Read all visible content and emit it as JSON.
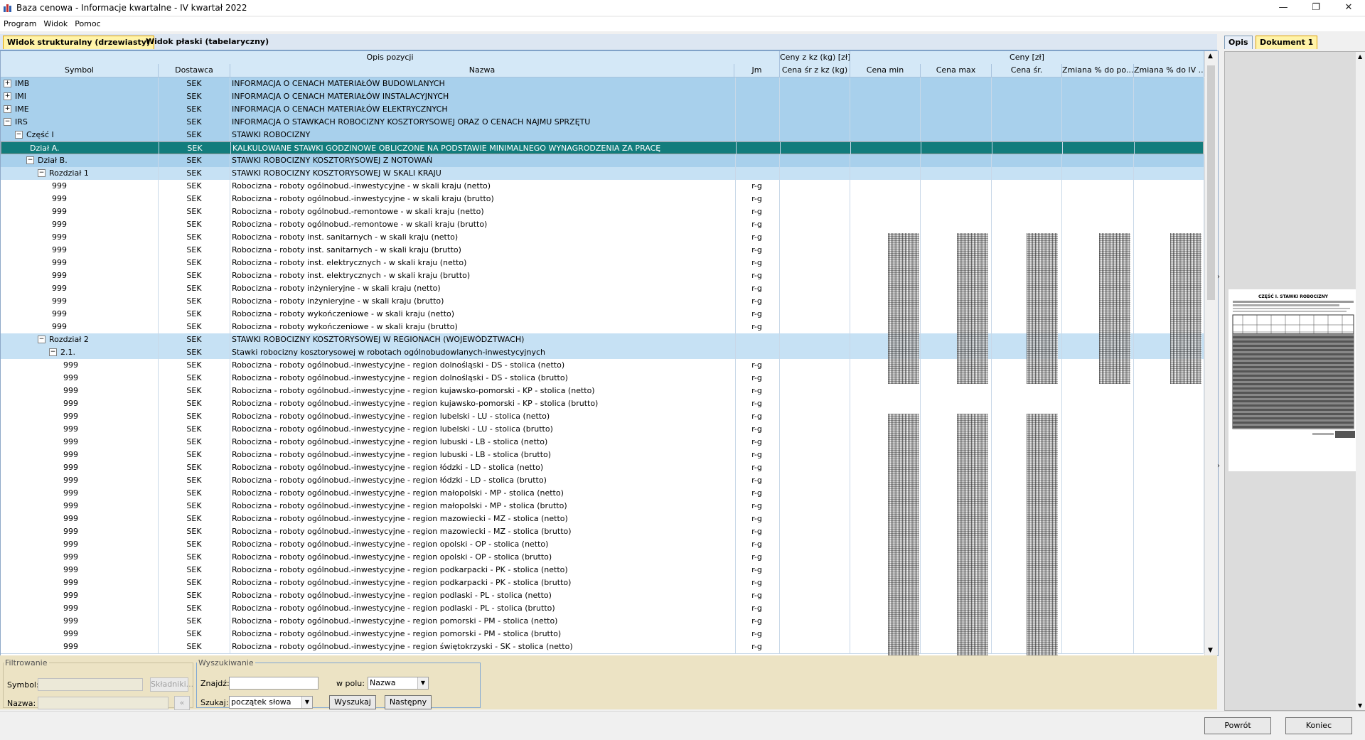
{
  "window": {
    "title": "Baza cenowa - Informacje kwartalne - IV kwartał 2022"
  },
  "menu": [
    "Program",
    "Widok",
    "Pomoc"
  ],
  "tabs": {
    "tree": "Widok strukturalny (drzewiasty)",
    "flat": "Widok płaski (tabelaryczny)"
  },
  "grid": {
    "groups": {
      "opis": "Opis pozycji",
      "kz": "Ceny z kz (kg) [zł]",
      "ceny": "Ceny [zł]"
    },
    "columns": {
      "symbol": "Symbol",
      "dostawca": "Dostawca",
      "nazwa": "Nazwa",
      "jm": "Jm",
      "kz": "Cena śr z kz (kg)",
      "min": "Cena min",
      "max": "Cena max",
      "sr": "Cena śr.",
      "z1": "Zmiana % do po...",
      "z2": "Zmiana % do IV ..."
    },
    "rows": [
      {
        "sym": "IMB",
        "lvl": 0,
        "tb": "+",
        "dos": "SEK",
        "naz": "INFORMACJA O CENACH MATERIAŁÓW BUDOWLANYCH",
        "jm": "",
        "t": "cat"
      },
      {
        "sym": "IMI",
        "lvl": 0,
        "tb": "+",
        "dos": "SEK",
        "naz": "INFORMACJA O CENACH MATERIAŁÓW INSTALACYJNYCH",
        "jm": "",
        "t": "cat"
      },
      {
        "sym": "IME",
        "lvl": 0,
        "tb": "+",
        "dos": "SEK",
        "naz": "INFORMACJA O CENACH MATERIAŁÓW ELEKTRYCZNYCH",
        "jm": "",
        "t": "cat"
      },
      {
        "sym": "IRS",
        "lvl": 0,
        "tb": "−",
        "dos": "SEK",
        "naz": "INFORMACJA O STAWKACH ROBOCIZNY KOSZTORYSOWEJ ORAZ O CENACH NAJMU SPRZĘTU",
        "jm": "",
        "t": "cat"
      },
      {
        "sym": "Część I",
        "lvl": 1,
        "tb": "−",
        "dos": "SEK",
        "naz": "STAWKI ROBOCIZNY",
        "jm": "",
        "t": "cat"
      },
      {
        "sym": "Dział A.",
        "lvl": 2,
        "tb": "",
        "dos": "SEK",
        "naz": "KALKULOWANE STAWKI GODZINOWE OBLICZONE NA PODSTAWIE MINIMALNEGO WYNAGRODZENIA ZA PRACĘ",
        "jm": "",
        "t": "sel"
      },
      {
        "sym": "Dział B.",
        "lvl": 2,
        "tb": "−",
        "dos": "SEK",
        "naz": "STAWKI ROBOCIZNY KOSZTORYSOWEJ Z NOTOWAŃ",
        "jm": "",
        "t": "cat"
      },
      {
        "sym": "Rozdział 1",
        "lvl": 3,
        "tb": "−",
        "dos": "SEK",
        "naz": "STAWKI ROBOCIZNY KOSZTORYSOWEJ W SKALI KRAJU",
        "jm": "",
        "t": "sub"
      },
      {
        "sym": "999",
        "lvl": 4,
        "tb": "",
        "dos": "SEK",
        "naz": "Robocizna - roboty ogólnobud.-inwestycyjne - w skali kraju (netto)",
        "jm": "r-g",
        "t": "item"
      },
      {
        "sym": "999",
        "lvl": 4,
        "tb": "",
        "dos": "SEK",
        "naz": "Robocizna - roboty ogólnobud.-inwestycyjne - w skali kraju (brutto)",
        "jm": "r-g",
        "t": "item"
      },
      {
        "sym": "999",
        "lvl": 4,
        "tb": "",
        "dos": "SEK",
        "naz": "Robocizna - roboty ogólnobud.-remontowe - w skali kraju (netto)",
        "jm": "r-g",
        "t": "item"
      },
      {
        "sym": "999",
        "lvl": 4,
        "tb": "",
        "dos": "SEK",
        "naz": "Robocizna - roboty ogólnobud.-remontowe - w skali kraju (brutto)",
        "jm": "r-g",
        "t": "item"
      },
      {
        "sym": "999",
        "lvl": 4,
        "tb": "",
        "dos": "SEK",
        "naz": "Robocizna - roboty inst. sanitarnych - w skali kraju (netto)",
        "jm": "r-g",
        "t": "item"
      },
      {
        "sym": "999",
        "lvl": 4,
        "tb": "",
        "dos": "SEK",
        "naz": "Robocizna - roboty inst. sanitarnych - w skali kraju (brutto)",
        "jm": "r-g",
        "t": "item"
      },
      {
        "sym": "999",
        "lvl": 4,
        "tb": "",
        "dos": "SEK",
        "naz": "Robocizna - roboty inst. elektrycznych - w skali kraju (netto)",
        "jm": "r-g",
        "t": "item"
      },
      {
        "sym": "999",
        "lvl": 4,
        "tb": "",
        "dos": "SEK",
        "naz": "Robocizna - roboty inst. elektrycznych - w skali kraju (brutto)",
        "jm": "r-g",
        "t": "item"
      },
      {
        "sym": "999",
        "lvl": 4,
        "tb": "",
        "dos": "SEK",
        "naz": "Robocizna - roboty inżynieryjne - w skali kraju (netto)",
        "jm": "r-g",
        "t": "item"
      },
      {
        "sym": "999",
        "lvl": 4,
        "tb": "",
        "dos": "SEK",
        "naz": "Robocizna - roboty inżynieryjne - w skali kraju (brutto)",
        "jm": "r-g",
        "t": "item"
      },
      {
        "sym": "999",
        "lvl": 4,
        "tb": "",
        "dos": "SEK",
        "naz": "Robocizna - roboty wykończeniowe - w skali kraju (netto)",
        "jm": "r-g",
        "t": "item"
      },
      {
        "sym": "999",
        "lvl": 4,
        "tb": "",
        "dos": "SEK",
        "naz": "Robocizna - roboty wykończeniowe - w skali kraju (brutto)",
        "jm": "r-g",
        "t": "item"
      },
      {
        "sym": "Rozdział 2",
        "lvl": 3,
        "tb": "−",
        "dos": "SEK",
        "naz": "STAWKI ROBOCIZNY KOSZTORYSOWEJ W REGIONACH (WOJEWÓDZTWACH)",
        "jm": "",
        "t": "sub"
      },
      {
        "sym": "2.1.",
        "lvl": 4,
        "tb": "−",
        "dos": "SEK",
        "naz": "Stawki robocizny kosztorysowej w robotach ogólnobudowlanych-inwestycyjnych",
        "jm": "",
        "t": "sub"
      },
      {
        "sym": "999",
        "lvl": 5,
        "tb": "",
        "dos": "SEK",
        "naz": "Robocizna - roboty ogólnobud.-inwestycyjne - region dolnośląski - DS - stolica (netto)",
        "jm": "r-g",
        "t": "item"
      },
      {
        "sym": "999",
        "lvl": 5,
        "tb": "",
        "dos": "SEK",
        "naz": "Robocizna - roboty ogólnobud.-inwestycyjne - region dolnośląski - DS - stolica (brutto)",
        "jm": "r-g",
        "t": "item"
      },
      {
        "sym": "999",
        "lvl": 5,
        "tb": "",
        "dos": "SEK",
        "naz": "Robocizna - roboty ogólnobud.-inwestycyjne - region kujawsko-pomorski - KP - stolica (netto)",
        "jm": "r-g",
        "t": "item"
      },
      {
        "sym": "999",
        "lvl": 5,
        "tb": "",
        "dos": "SEK",
        "naz": "Robocizna - roboty ogólnobud.-inwestycyjne - region kujawsko-pomorski - KP - stolica (brutto)",
        "jm": "r-g",
        "t": "item"
      },
      {
        "sym": "999",
        "lvl": 5,
        "tb": "",
        "dos": "SEK",
        "naz": "Robocizna - roboty ogólnobud.-inwestycyjne - region lubelski - LU - stolica (netto)",
        "jm": "r-g",
        "t": "item"
      },
      {
        "sym": "999",
        "lvl": 5,
        "tb": "",
        "dos": "SEK",
        "naz": "Robocizna - roboty ogólnobud.-inwestycyjne - region lubelski - LU - stolica (brutto)",
        "jm": "r-g",
        "t": "item"
      },
      {
        "sym": "999",
        "lvl": 5,
        "tb": "",
        "dos": "SEK",
        "naz": "Robocizna - roboty ogólnobud.-inwestycyjne - region lubuski - LB - stolica (netto)",
        "jm": "r-g",
        "t": "item"
      },
      {
        "sym": "999",
        "lvl": 5,
        "tb": "",
        "dos": "SEK",
        "naz": "Robocizna - roboty ogólnobud.-inwestycyjne - region lubuski - LB - stolica (brutto)",
        "jm": "r-g",
        "t": "item"
      },
      {
        "sym": "999",
        "lvl": 5,
        "tb": "",
        "dos": "SEK",
        "naz": "Robocizna - roboty ogólnobud.-inwestycyjne - region łódzki - LD - stolica (netto)",
        "jm": "r-g",
        "t": "item"
      },
      {
        "sym": "999",
        "lvl": 5,
        "tb": "",
        "dos": "SEK",
        "naz": "Robocizna - roboty ogólnobud.-inwestycyjne - region łódzki - LD - stolica (brutto)",
        "jm": "r-g",
        "t": "item"
      },
      {
        "sym": "999",
        "lvl": 5,
        "tb": "",
        "dos": "SEK",
        "naz": "Robocizna - roboty ogólnobud.-inwestycyjne - region małopolski - MP - stolica (netto)",
        "jm": "r-g",
        "t": "item"
      },
      {
        "sym": "999",
        "lvl": 5,
        "tb": "",
        "dos": "SEK",
        "naz": "Robocizna - roboty ogólnobud.-inwestycyjne - region małopolski - MP - stolica (brutto)",
        "jm": "r-g",
        "t": "item"
      },
      {
        "sym": "999",
        "lvl": 5,
        "tb": "",
        "dos": "SEK",
        "naz": "Robocizna - roboty ogólnobud.-inwestycyjne - region mazowiecki - MZ - stolica (netto)",
        "jm": "r-g",
        "t": "item"
      },
      {
        "sym": "999",
        "lvl": 5,
        "tb": "",
        "dos": "SEK",
        "naz": "Robocizna - roboty ogólnobud.-inwestycyjne - region mazowiecki - MZ - stolica (brutto)",
        "jm": "r-g",
        "t": "item"
      },
      {
        "sym": "999",
        "lvl": 5,
        "tb": "",
        "dos": "SEK",
        "naz": "Robocizna - roboty ogólnobud.-inwestycyjne - region opolski - OP - stolica (netto)",
        "jm": "r-g",
        "t": "item"
      },
      {
        "sym": "999",
        "lvl": 5,
        "tb": "",
        "dos": "SEK",
        "naz": "Robocizna - roboty ogólnobud.-inwestycyjne - region opolski - OP - stolica (brutto)",
        "jm": "r-g",
        "t": "item"
      },
      {
        "sym": "999",
        "lvl": 5,
        "tb": "",
        "dos": "SEK",
        "naz": "Robocizna - roboty ogólnobud.-inwestycyjne - region podkarpacki - PK - stolica (netto)",
        "jm": "r-g",
        "t": "item"
      },
      {
        "sym": "999",
        "lvl": 5,
        "tb": "",
        "dos": "SEK",
        "naz": "Robocizna - roboty ogólnobud.-inwestycyjne - region podkarpacki - PK - stolica (brutto)",
        "jm": "r-g",
        "t": "item"
      },
      {
        "sym": "999",
        "lvl": 5,
        "tb": "",
        "dos": "SEK",
        "naz": "Robocizna - roboty ogólnobud.-inwestycyjne - region podlaski - PL - stolica (netto)",
        "jm": "r-g",
        "t": "item"
      },
      {
        "sym": "999",
        "lvl": 5,
        "tb": "",
        "dos": "SEK",
        "naz": "Robocizna - roboty ogólnobud.-inwestycyjne - region podlaski - PL - stolica (brutto)",
        "jm": "r-g",
        "t": "item"
      },
      {
        "sym": "999",
        "lvl": 5,
        "tb": "",
        "dos": "SEK",
        "naz": "Robocizna - roboty ogólnobud.-inwestycyjne - region pomorski - PM - stolica (netto)",
        "jm": "r-g",
        "t": "item"
      },
      {
        "sym": "999",
        "lvl": 5,
        "tb": "",
        "dos": "SEK",
        "naz": "Robocizna - roboty ogólnobud.-inwestycyjne - region pomorski - PM - stolica (brutto)",
        "jm": "r-g",
        "t": "item"
      },
      {
        "sym": "999",
        "lvl": 5,
        "tb": "",
        "dos": "SEK",
        "naz": "Robocizna - roboty ogólnobud.-inwestycyjne - region świętokrzyski - SK - stolica (netto)",
        "jm": "r-g",
        "t": "item"
      }
    ]
  },
  "filter": {
    "legend": "Filtrowanie",
    "symbol_label": "Symbol:",
    "nazwa_label": "Nazwa:",
    "skladniki": "Składniki..."
  },
  "search": {
    "legend": "Wyszukiwanie",
    "find_label": "Znajdź:",
    "field_label": "w polu:",
    "field_value": "Nazwa",
    "mode_label": "Szukaj:",
    "mode_value": "początek słowa",
    "search_btn": "Wyszukaj",
    "next_btn": "Następny"
  },
  "right_tabs": {
    "opis": "Opis",
    "dokument": "Dokument 1"
  },
  "preview_doc": {
    "title": "CZĘŚĆ I.  STAWKI ROBOCIZNY"
  },
  "footer": {
    "back": "Powrót",
    "end": "Koniec"
  }
}
